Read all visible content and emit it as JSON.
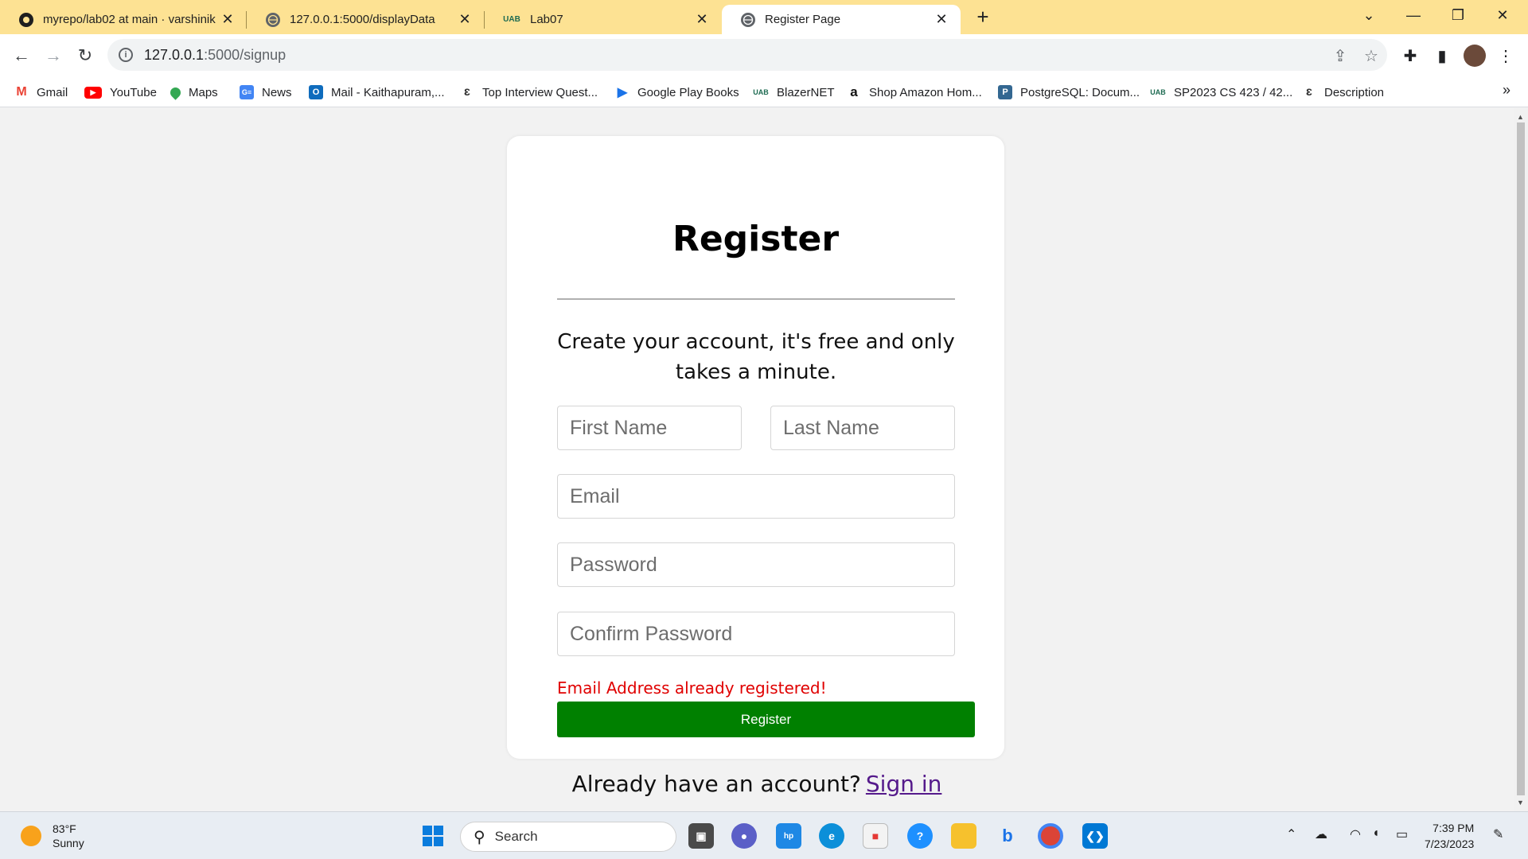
{
  "browser": {
    "tabs": [
      {
        "title": "myrepo/lab02 at main · varshinik",
        "icon": "github-icon"
      },
      {
        "title": "127.0.0.1:5000/displayData",
        "icon": "globe-icon"
      },
      {
        "title": "Lab07",
        "icon": "uab-icon"
      },
      {
        "title": "Register Page",
        "icon": "globe-icon",
        "active": true
      }
    ],
    "url_host": "127.0.0.1",
    "url_path": ":5000/signup",
    "bookmarks": [
      {
        "label": "Gmail",
        "icon": "gmail-icon"
      },
      {
        "label": "YouTube",
        "icon": "youtube-icon"
      },
      {
        "label": "Maps",
        "icon": "maps-icon"
      },
      {
        "label": "News",
        "icon": "news-icon"
      },
      {
        "label": "Mail - Kaithapuram,...",
        "icon": "outlook-icon"
      },
      {
        "label": "Top Interview Quest...",
        "icon": "leetcode-icon"
      },
      {
        "label": "Google Play Books",
        "icon": "play-books-icon"
      },
      {
        "label": "BlazerNET",
        "icon": "uab-icon"
      },
      {
        "label": "Shop Amazon Hom...",
        "icon": "amazon-icon"
      },
      {
        "label": "PostgreSQL: Docum...",
        "icon": "postgresql-icon"
      },
      {
        "label": "SP2023 CS 423 / 42...",
        "icon": "uab-icon"
      },
      {
        "label": "Description",
        "icon": "leetcode-icon"
      }
    ]
  },
  "form": {
    "title": "Register",
    "subtitle": "Create your account, it's free and only takes a minute.",
    "first_name_placeholder": "First Name",
    "last_name_placeholder": "Last Name",
    "email_placeholder": "Email",
    "password_placeholder": "Password",
    "confirm_password_placeholder": "Confirm Password",
    "error_message": "Email Address already registered!",
    "submit_label": "Register",
    "signin_prompt": "Already have an account?",
    "signin_link": "Sign in"
  },
  "taskbar": {
    "weather_temp": "83°F",
    "weather_desc": "Sunny",
    "search_label": "Search",
    "time": "7:39 PM",
    "date": "7/23/2023"
  },
  "colors": {
    "tabstrip": "#fde293",
    "register_button": "#008000",
    "error_text": "#e00000",
    "link": "#551a8b"
  }
}
